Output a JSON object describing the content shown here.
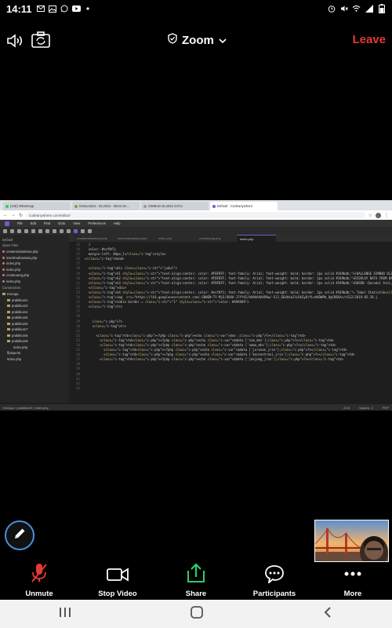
{
  "status": {
    "time": "14:11",
    "left_icons": [
      "email-icon",
      "image-icon",
      "whatsapp-icon",
      "youtube-icon",
      "dot-icon"
    ],
    "right_icons": [
      "alarm-icon",
      "mute-icon",
      "wifi-icon",
      "signal-icon",
      "battery-icon"
    ]
  },
  "meeting": {
    "title": "Zoom",
    "leave_label": "Leave"
  },
  "browser": {
    "tabs": [
      {
        "label": "(108) WhatsApp",
        "color": "#25d366"
      },
      {
        "label": "Instructions - DL2015 - Sitem Ke...",
        "color": "#6aa84f"
      },
      {
        "label": "SIMBAD DL2015 SATU",
        "color": "#999999"
      },
      {
        "label": "Default - Codeanywhere",
        "color": "#7b57d1"
      }
    ],
    "url": "codeanywhere.com/editor/"
  },
  "editor": {
    "menu": [
      "File",
      "Edit",
      "Find",
      "Goto",
      "View",
      "Preferences",
      "Help"
    ],
    "sidebar_title": "Default",
    "open_files_label": "Open Files",
    "open_files": [
      "createmahasiswa.php",
      "insertmahasiswa.php",
      "index.php",
      "index.php",
      "createuang.php",
      "index.php"
    ],
    "connections_label": "Connections",
    "root_folder": "Keonga",
    "folders": [
      "praktikum1",
      "praktikum2",
      "praktikum4",
      "praktikum5",
      "praktikum6",
      "praktikum7",
      "praktikum8",
      "praktikum9"
    ],
    "subfiles": [
      "index.php",
      "ffpsquota",
      "index.php"
    ],
    "active_tab": "index.php",
    "inactive_tabs": [
      "createmahasiswa.php",
      "insertmahasiswa.php",
      "index.php",
      "createuang.php"
    ],
    "code_lines": [
      {
        "n": "13",
        "t": "  }"
      },
      {
        "n": "14",
        "t": "  color: #ecf0f1;"
      },
      {
        "n": "15",
        "t": "  margin-left: 40px;}</style>"
      },
      {
        "n": "16",
        "t": "</head>"
      },
      {
        "n": "17",
        "t": ""
      },
      {
        "n": "18",
        "t": "  <div class=\"judul\">"
      },
      {
        "n": "19",
        "t": "  <h1 style=\"text-align:center; color: #FBFBFF; font-family: Arial; font-weight: bold; border: 2px solid #349bdb;\">CHALLENGE SIMBAD DL2015</h1>"
      },
      {
        "n": "20",
        "t": "  <h2 style=\"text-align:center; color: #FBFBFF; font-family: Arial; font-weight: bold; border: 2px solid #349bdb;\">DISPLAY DATA FROM DATABASE |"
      },
      {
        "n": "21",
        "t": "  <h3 style=\"text-align:center; color: #FBFBFF; font-family: Arial; font-weight: bold; border: 2px solid #349bdb;\">DOSEN :Qarodul Aini, S.Kom., M"
      },
      {
        "n": "22",
        "t": "  </div>"
      },
      {
        "n": "23",
        "t": "  <h4 style=\"text-align:center; color: #ecf0f1; font-family: Arial; font-weight: bold; border: 2px solid #349bdb;\"> Tabel Statistik</h4>"
      },
      {
        "n": "24",
        "t": "  <img  src=\"https://lh3.googleusercontent.com/-GRWEN-TY-MjE/XO4A-J7fY4I/AAAAAAAAP0w/-Sl2_GEdkhaJlLOkZyDrYLohKDWPb_OgCKBGAs/s512/2019-05-28.j"
      },
      {
        "n": "25",
        "t": "  <table border = \"1\" style=\"color: #A9A9A9\">"
      },
      {
        "n": "26",
        "t": "  <tr>"
      },
      {
        "n": "27",
        "t": ""
      },
      {
        "n": "28",
        "t": ""
      },
      {
        "n": "29",
        "t": "    ?>"
      },
      {
        "n": "30",
        "t": "    <tr>"
      },
      {
        "n": "31",
        "t": ""
      },
      {
        "n": "32",
        "t": "      <td><?php echo $no ;?></td>"
      },
      {
        "n": "33",
        "t": "        <td><?php echo $data ['nim_mhs'];?></td>"
      },
      {
        "n": "34",
        "t": "        <td><?php echo $data ['nama_mhs'];?></td>"
      },
      {
        "n": "35",
        "t": "          <td><?php echo $data ['jurusan_jrsn'];?></td>"
      },
      {
        "n": "36",
        "t": "          <td><?php echo $data ['konsentrasi_jrsn'];?></td>"
      },
      {
        "n": "37",
        "t": "        <td><?php echo $data ['jenjang_jrsn'];?></td>"
      },
      {
        "n": "38",
        "t": ""
      },
      {
        "n": "39",
        "t": ""
      },
      {
        "n": "40",
        "t": ""
      },
      {
        "n": "41",
        "t": ""
      },
      {
        "n": "42",
        "t": ""
      },
      {
        "n": "43",
        "t": ""
      }
    ],
    "statusline_path": "Keonga › praktikum9 › index.php",
    "statusline_pos": "23:6",
    "statusline_spaces": "Spaces: 2",
    "statusline_lang": "PHP"
  },
  "controls": {
    "unmute_label": "Unmute",
    "stop_video_label": "Stop Video",
    "share_label": "Share",
    "participants_label": "Participants",
    "more_label": "More"
  },
  "colors": {
    "leave": "#e53935",
    "share_green": "#2ecc71",
    "mute_red": "#e53935",
    "pen_ring": "#4a90d9"
  }
}
